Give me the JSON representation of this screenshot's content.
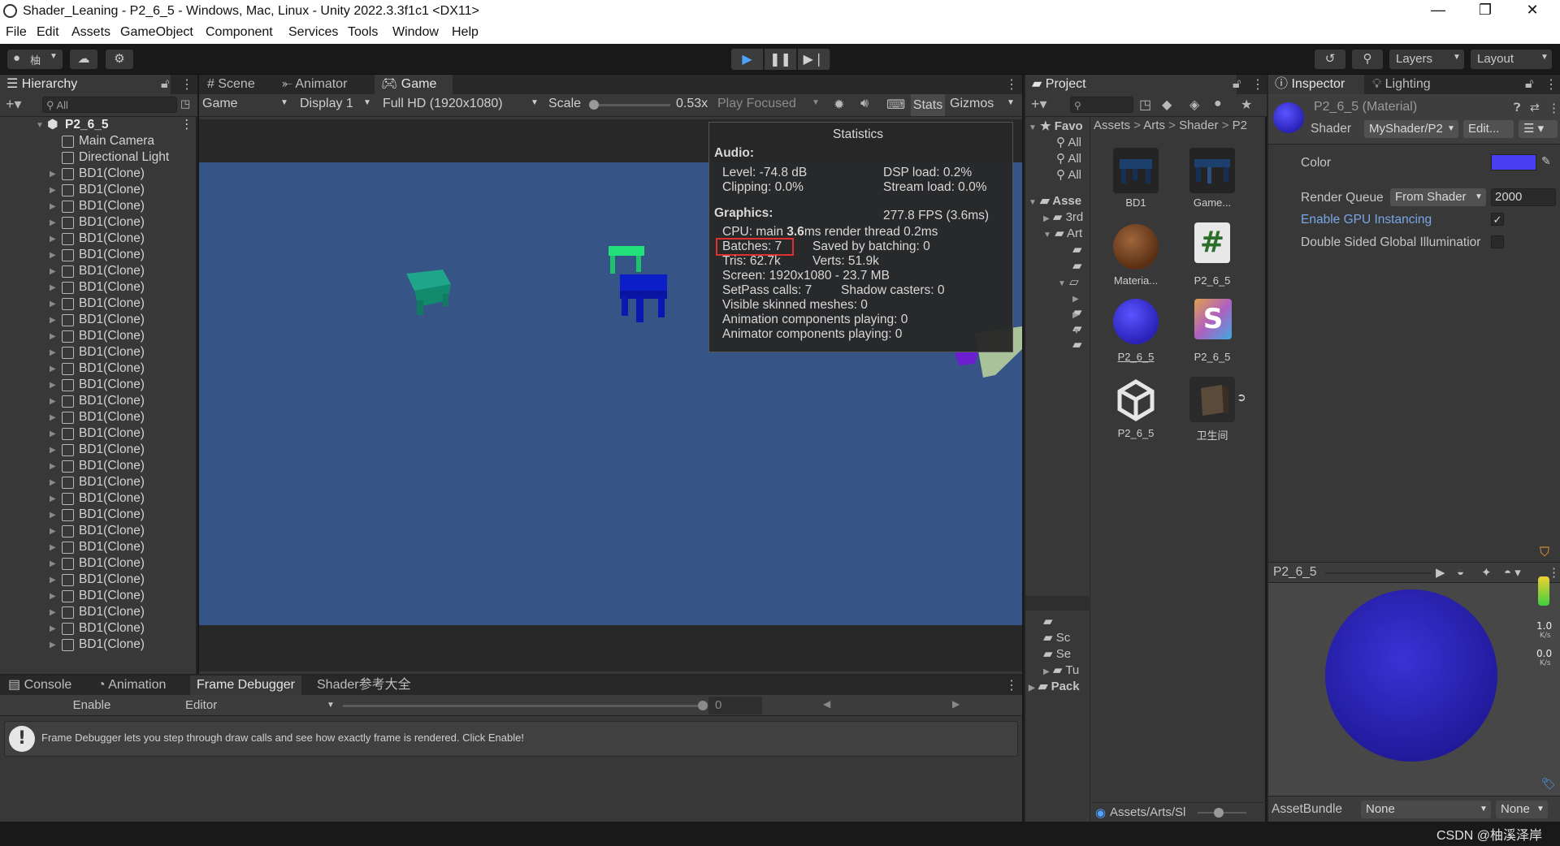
{
  "window": {
    "title": "Shader_Leaning - P2_6_5 - Windows, Mac, Linux - Unity 2022.3.3f1c1 <DX11>",
    "minimize": "—",
    "maximize": "❐",
    "close": "✕"
  },
  "menu": [
    "File",
    "Edit",
    "Assets",
    "GameObject",
    "Component",
    "Services",
    "Tools",
    "Window",
    "Help"
  ],
  "toolbar": {
    "account": "柚",
    "layers": "Layers",
    "layout": "Layout"
  },
  "hierarchy": {
    "tab": "Hierarchy",
    "search_placeholder": "All",
    "scene": "P2_6_5",
    "root_items": [
      "Main Camera",
      "Directional Light"
    ],
    "clones": [
      "BD1(Clone)",
      "BD1(Clone)",
      "BD1(Clone)",
      "BD1(Clone)",
      "BD1(Clone)",
      "BD1(Clone)",
      "BD1(Clone)",
      "BD1(Clone)",
      "BD1(Clone)",
      "BD1(Clone)",
      "BD1(Clone)",
      "BD1(Clone)",
      "BD1(Clone)",
      "BD1(Clone)",
      "BD1(Clone)",
      "BD1(Clone)",
      "BD1(Clone)",
      "BD1(Clone)",
      "BD1(Clone)",
      "BD1(Clone)",
      "BD1(Clone)",
      "BD1(Clone)",
      "BD1(Clone)",
      "BD1(Clone)",
      "BD1(Clone)",
      "BD1(Clone)",
      "BD1(Clone)",
      "BD1(Clone)",
      "BD1(Clone)",
      "BD1(Clone)"
    ]
  },
  "center": {
    "tabs": [
      "Scene",
      "Animator",
      "Game"
    ],
    "game_dropdown": "Game",
    "display": "Display 1",
    "resolution": "Full HD (1920x1080)",
    "scale_label": "Scale",
    "scale_value": "0.53x",
    "play_focused": "Play Focused",
    "stats": "Stats",
    "gizmos": "Gizmos",
    "scale_fraction": 0.0
  },
  "stats": {
    "title": "Statistics",
    "audio_header": "Audio:",
    "level": "Level: -74.8 dB",
    "clipping": "Clipping: 0.0%",
    "dsp": "DSP load: 0.2%",
    "stream": "Stream load: 0.0%",
    "graphics_header": "Graphics:",
    "fps": "277.8 FPS (3.6ms)",
    "cpu_prefix": "CPU: main ",
    "cpu_main": "3.6",
    "cpu_suffix": "ms  render thread 0.2ms",
    "batches": "Batches: 7",
    "saved": "Saved by batching: 0",
    "tris": "Tris: 62.7k",
    "verts": "Verts: 51.9k",
    "screen": "Screen: 1920x1080 - 23.7 MB",
    "setpass": "SetPass calls: 7",
    "shadow": "Shadow casters: 0",
    "skinned": "Visible skinned meshes: 0",
    "anim_comp": "Animation components playing: 0",
    "animator_comp": "Animator components playing: 0"
  },
  "console": {
    "tabs": [
      "Console",
      "Animation",
      "Frame Debugger",
      "Shader参考大全"
    ],
    "enable": "Enable",
    "editor": "Editor",
    "frame_value": "0",
    "message": "Frame Debugger lets you step through draw calls and see how exactly frame is rendered. Click Enable!"
  },
  "project": {
    "tab": "Project",
    "breadcrumb": [
      "Assets",
      "Arts",
      "Shader",
      "P2"
    ],
    "tree": [
      "Favo",
      "All",
      "All",
      "All",
      "Asse",
      "3rd",
      "Art",
      "Sc",
      "Se",
      "Tu",
      "Pack"
    ],
    "assets": [
      {
        "label": "BD1"
      },
      {
        "label": "Game..."
      },
      {
        "label": "Materia..."
      },
      {
        "label": "P2_6_5"
      },
      {
        "label": "P2_6_5"
      },
      {
        "label": "P2_6_5"
      },
      {
        "label": "P2_6_5"
      },
      {
        "label": "卫生间"
      }
    ],
    "footer_path": "Assets/Arts/Sl"
  },
  "inspector": {
    "tabs": [
      "Inspector",
      "Lighting"
    ],
    "material_name": "P2_6_5 (Material)",
    "shader_label": "Shader",
    "shader_value": "MyShader/P2",
    "edit_button": "Edit...",
    "color_label": "Color",
    "color_value": "#4a3ff0",
    "render_queue_label": "Render Queue",
    "render_queue_mode": "From Shader",
    "render_queue_value": "2000",
    "gpu_instancing_label": "Enable GPU Instancing",
    "gpu_instancing": true,
    "double_sided_label": "Double Sided Global Illuminatior",
    "double_sided": false,
    "preview_name": "P2_6_5",
    "preview_color": "#3b32d6",
    "net_up": "1.0",
    "net_up_unit": "K/s",
    "net_down": "0.0",
    "net_down_unit": "K/s",
    "assetbundle_label": "AssetBundle",
    "assetbundle_value": "None",
    "assetbundle_variant": "None"
  },
  "watermark": "CSDN @柚溪泽岸",
  "colors": {
    "game_bg": "#375486",
    "highlight_box": "#e03030",
    "accent_link": "#7aa6e8"
  }
}
